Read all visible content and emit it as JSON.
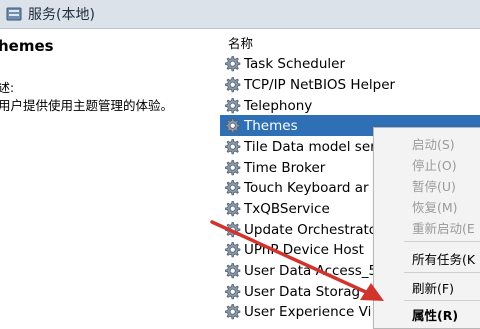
{
  "window": {
    "title": "服务(本地)",
    "icon": "services-icon"
  },
  "left_pane": {
    "title": "hemes",
    "label": "述:",
    "description": "用户提供使用主题管理的体验。"
  },
  "list_header": {
    "name_column": "名称"
  },
  "services": [
    {
      "name": "Task Scheduler",
      "icon": "gear-icon"
    },
    {
      "name": "TCP/IP NetBIOS Helper",
      "icon": "gear-icon"
    },
    {
      "name": "Telephony",
      "icon": "gear-icon"
    },
    {
      "name": "Themes",
      "icon": "gear-icon",
      "selected": true
    },
    {
      "name": "Tile Data model ser",
      "icon": "gear-icon"
    },
    {
      "name": "Time Broker",
      "icon": "gear-icon"
    },
    {
      "name": "Touch Keyboard ar",
      "icon": "gear-icon"
    },
    {
      "name": "TxQBService",
      "icon": "gear-icon"
    },
    {
      "name": "Update Orchestrato",
      "icon": "gear-icon"
    },
    {
      "name": "UPnP Device Host",
      "icon": "gear-icon"
    },
    {
      "name": "User Data Access_5",
      "icon": "gear-icon"
    },
    {
      "name": "User Data Storag",
      "icon": "gear-icon"
    },
    {
      "name": "User Experience Vi",
      "icon": "gear-icon"
    }
  ],
  "context_menu": {
    "start": "启动(S)",
    "stop": "停止(O)",
    "pause": "暂停(U)",
    "resume": "恢复(M)",
    "restart": "重新启动(E",
    "all_tasks": "所有任务(K",
    "refresh": "刷新(F)",
    "properties": "属性(R)"
  },
  "colors": {
    "selection": "#2f6fb6",
    "arrow": "#d0342c"
  }
}
